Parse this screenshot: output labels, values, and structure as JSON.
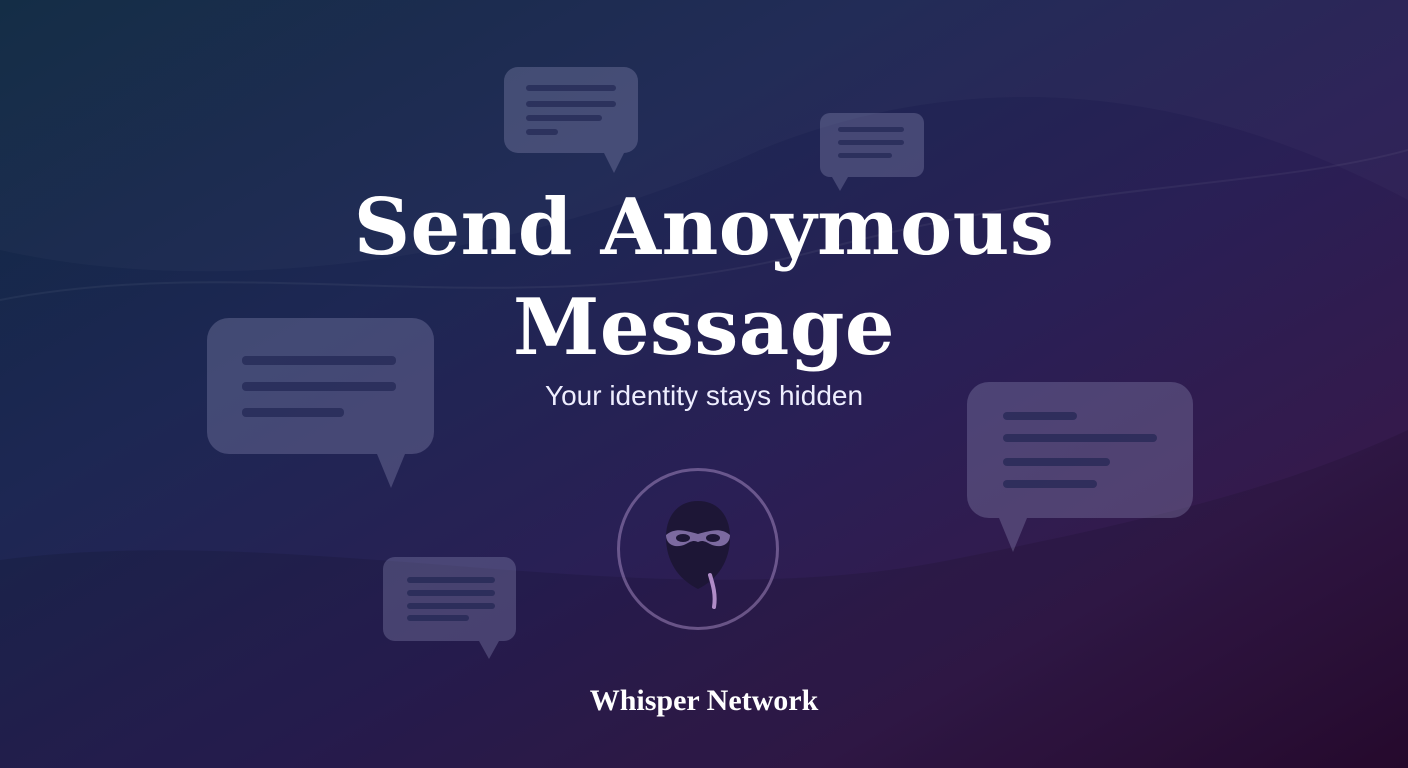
{
  "hero": {
    "title_line1": "Send Anoymous",
    "title_line2": "Message",
    "tagline": "Your identity stays hidden"
  },
  "brand": {
    "name": "Whisper Network"
  },
  "icons": {
    "center": "masked-figure-icon",
    "decor": "chat-bubble-icon"
  },
  "colors": {
    "gradient_start": "#0f2842",
    "gradient_mid": "#2a1f55",
    "gradient_end": "#2a0b32",
    "text": "#ffffff"
  }
}
